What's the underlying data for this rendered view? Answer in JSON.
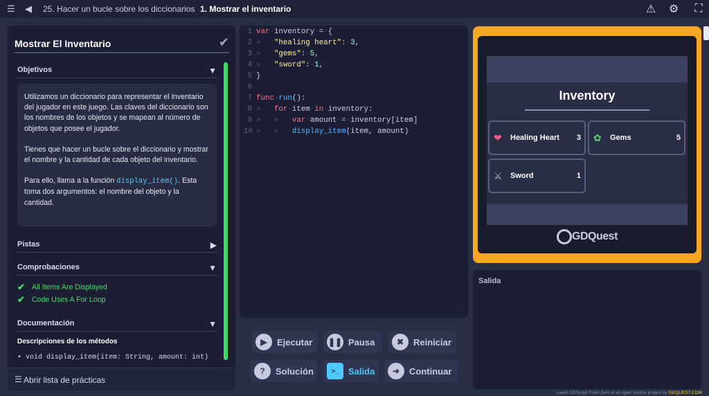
{
  "topbar": {
    "breadcrumb_lesson": "25. Hacer un bucle sobre los diccionarios",
    "breadcrumb_separator": "›",
    "breadcrumb_practice": "1. Mostrar el inventario",
    "icons": [
      "menu-icon",
      "back-arrow-icon",
      "warning-icon",
      "settings-gear-icon",
      "fullscreen-icon"
    ]
  },
  "left_panel": {
    "title": "Mostrar El Inventario",
    "sections": {
      "objectives": "Objetivos",
      "hints": "Pistas",
      "checks": "Comprobaciones",
      "docs": "Documentación"
    },
    "objectives_p1": "Utilizamos un diccionario para representar el inventario del jugador en este juego. Las claves del diccionario son los nombres de los objetos y se mapean al número de objetos que posee el jugador.",
    "objectives_p2": "Tienes que hacer un bucle sobre el diccionario y mostrar el nombre y la cantidad de cada objeto del inventario.",
    "objectives_p3_before": "Para ello, llama a la función ",
    "objectives_p3_code": "display_item()",
    "objectives_p3_after": ". Esta toma dos argumentos: el nombre del objeto y la cantidad.",
    "checks": [
      "All Items Are Displayed",
      "Code Uses A For Loop"
    ],
    "docs_subtitle": "Descripciones de los métodos",
    "docs_signature": "• void display_item(item: String, amount: int)",
    "footer_link": "Abrir lista de prácticas"
  },
  "editor": {
    "line_numbers": [
      "1",
      "2",
      "3",
      "4",
      "5",
      "6",
      "7",
      "8",
      "9",
      "10"
    ],
    "tokens": {
      "var": "var",
      "inventory": "inventory",
      "eq": "=",
      "brace_open": "{",
      "brace_close": "}",
      "healing_heart": "\"healing heart\"",
      "gems": "\"gems\"",
      "sword": "\"sword\"",
      "colon": ":",
      "three": "3",
      "five": "5",
      "one": "1",
      "comma": ",",
      "func": "func",
      "run": "run",
      "parens_colon": "():",
      "for": "for",
      "item": "item",
      "in": "in",
      "amount": "amount",
      "index_expr": "inventory[item]",
      "display_item": "display_item",
      "args": "(item, amount)"
    }
  },
  "buttons": {
    "run": "Ejecutar",
    "pause": "Pausa",
    "reset": "Reiniciar",
    "solution": "Solución",
    "output": "Salida",
    "continue": "Continuar"
  },
  "game": {
    "title": "Inventory",
    "items": [
      {
        "name": "Healing Heart",
        "count": "3",
        "icon": "heart-icon"
      },
      {
        "name": "Gems",
        "count": "5",
        "icon": "gems-icon"
      },
      {
        "name": "Sword",
        "count": "1",
        "icon": "sword-icon"
      }
    ],
    "logo": "GDQuest"
  },
  "output_panel": {
    "label": "Salida"
  },
  "footer": {
    "text": "Learn GDScript From Zero is an open source project by",
    "link": "GDQUEST.COM"
  },
  "colors": {
    "background": "#2a2e45",
    "panel": "#1c1f33",
    "accent_orange": "#f5a623",
    "success_green": "#3ddc62",
    "active_blue": "#4fc8ff"
  }
}
